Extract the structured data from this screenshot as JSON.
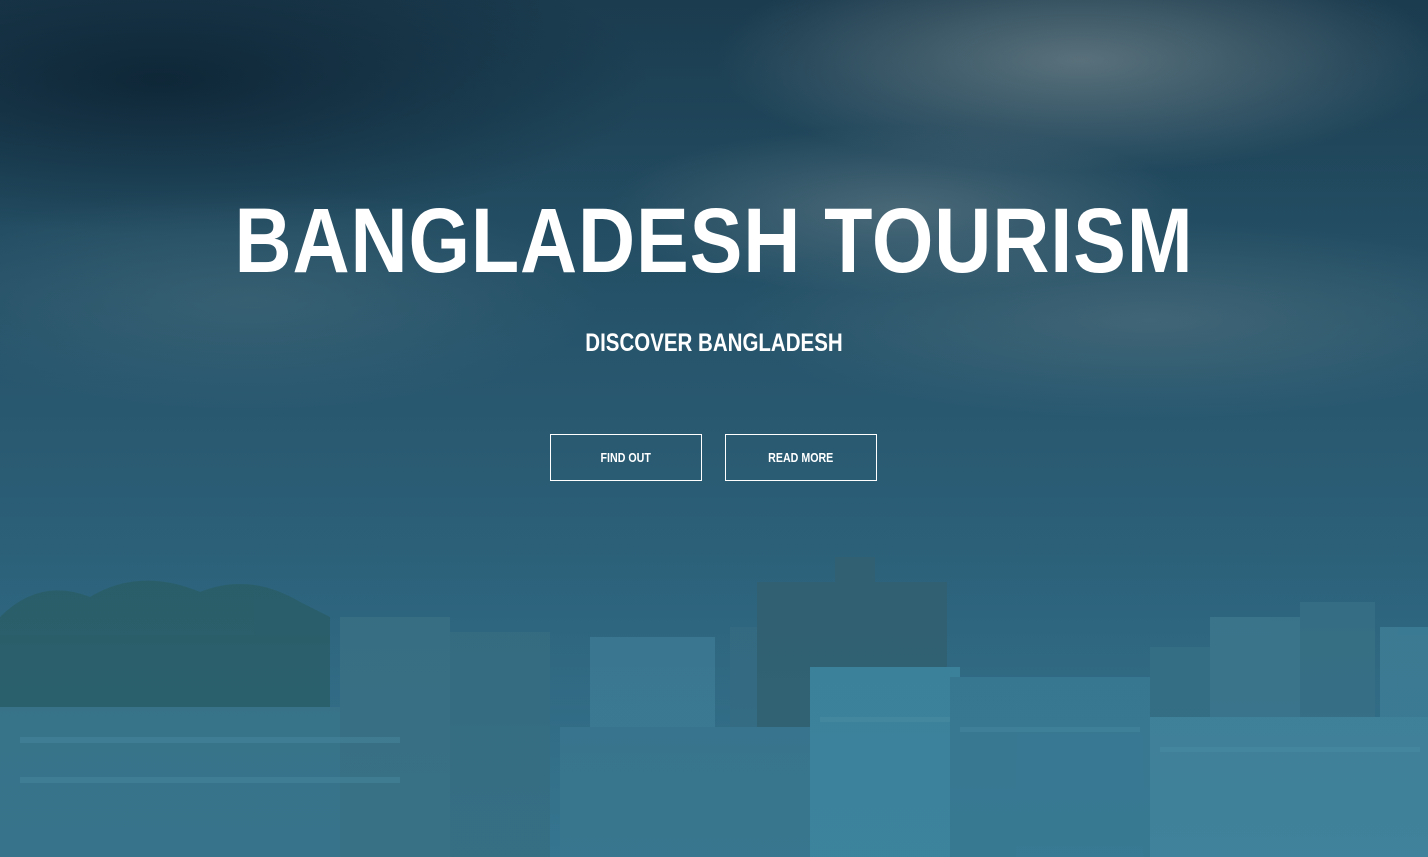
{
  "hero": {
    "title": "BANGLADESH TOURISM",
    "subtitle": "DISCOVER BANGLADESH",
    "buttons": {
      "find_out": "FIND OUT",
      "read_more": "READ MORE"
    }
  },
  "colors": {
    "text": "#ffffff",
    "overlay": "#2d6078"
  }
}
